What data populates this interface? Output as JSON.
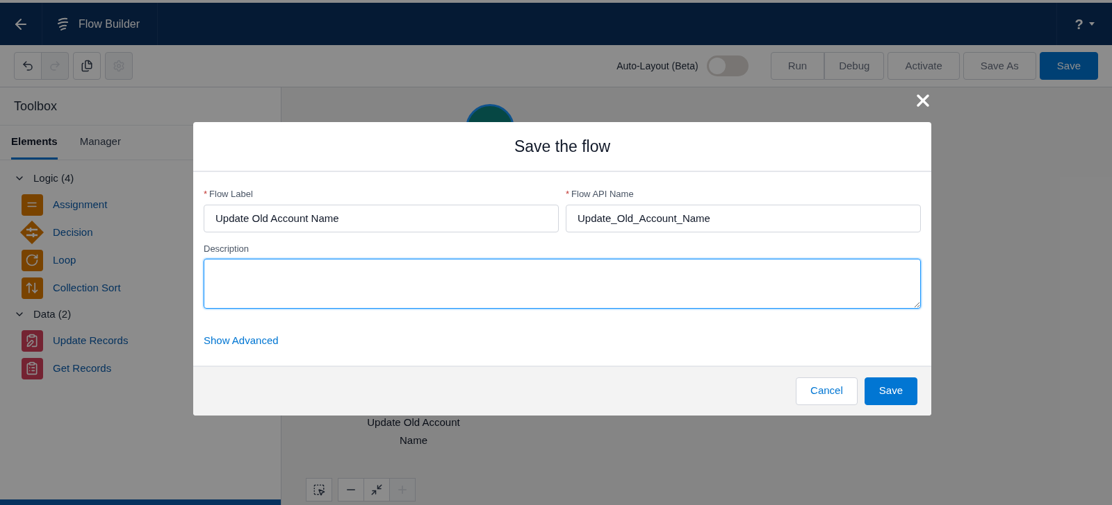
{
  "header": {
    "title": "Flow Builder",
    "help": "?"
  },
  "toolbar": {
    "icons": [
      {
        "kind": "undo",
        "disabled": false
      },
      {
        "kind": "redo",
        "disabled": true
      },
      {
        "kind": "copy",
        "disabled": false
      },
      {
        "kind": "settings",
        "disabled": true
      }
    ],
    "auto_layout": {
      "label": "Auto-Layout (Beta)",
      "on": false
    },
    "buttons": [
      {
        "label": "Run",
        "kind": "neutral",
        "disabled": true
      },
      {
        "label": "Debug",
        "kind": "neutral",
        "disabled": true
      },
      {
        "label": "Activate",
        "kind": "neutral",
        "disabled": true
      },
      {
        "label": "Save As",
        "kind": "neutral",
        "disabled": true
      },
      {
        "label": "Save",
        "kind": "brand",
        "disabled": false
      }
    ]
  },
  "toolbox": {
    "title": "Toolbox",
    "tabs": [
      {
        "label": "Elements",
        "selected": true
      },
      {
        "label": "Manager",
        "selected": false
      }
    ],
    "groups": [
      {
        "label": "Logic (4)",
        "expanded": true,
        "children": [
          {
            "label": "Assignment",
            "kind": "assignment"
          },
          {
            "label": "Decision",
            "kind": "decision"
          },
          {
            "label": "Loop",
            "kind": "loop"
          },
          {
            "label": "Collection Sort",
            "kind": "sort"
          }
        ]
      },
      {
        "label": "Data (2)",
        "expanded": true,
        "children": [
          {
            "label": "Update Records",
            "kind": "update"
          },
          {
            "label": "Get Records",
            "kind": "get"
          }
        ]
      }
    ]
  },
  "canvas": {
    "node_label": "Update Old Account Name",
    "zoom_controls": [
      {
        "kind": "select",
        "disabled": false
      },
      {
        "kind": "zoom_out",
        "disabled": false
      },
      {
        "kind": "fit",
        "disabled": false
      },
      {
        "kind": "zoom_in",
        "disabled": true
      }
    ]
  },
  "modal": {
    "title": "Save the flow",
    "fields": [
      {
        "label": "Flow Label",
        "required_mark": "*",
        "value": "Update Old Account Name"
      },
      {
        "label": "Flow API Name",
        "required_mark": "*",
        "value": "Update_Old_Account_Name"
      }
    ],
    "description": {
      "label": "Description",
      "focused": true
    },
    "show_advanced": "Show Advanced",
    "buttons": [
      {
        "label": "Cancel",
        "kind": "neutral"
      },
      {
        "label": "Save",
        "kind": "brand"
      }
    ]
  }
}
